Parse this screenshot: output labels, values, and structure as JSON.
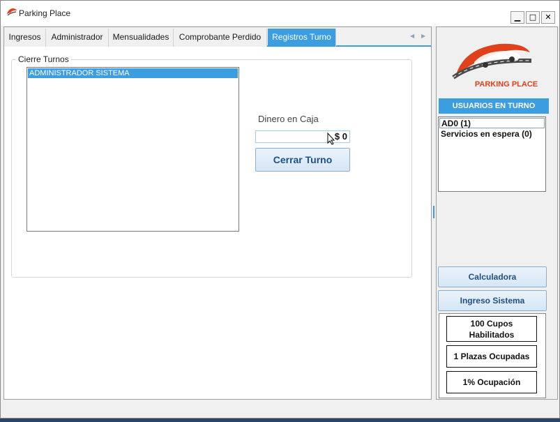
{
  "window": {
    "title": "Parking Place",
    "controls": {
      "minimize": "▁",
      "maximize": "□",
      "close": "✕"
    }
  },
  "tabs": [
    {
      "label": "Ingresos",
      "active": false
    },
    {
      "label": "Administrador",
      "active": false
    },
    {
      "label": "Mensualidades",
      "active": false
    },
    {
      "label": "Comprobante Perdido",
      "active": false
    },
    {
      "label": "Registros Turno",
      "active": true
    }
  ],
  "tab_scroll": {
    "left": "◀",
    "right": "▶"
  },
  "cierre": {
    "group_title": "Cierre Turnos",
    "users": [
      "ADMINISTRADOR SISTEMA"
    ],
    "cash_label": "Dinero en Caja",
    "cash_value": "$ 0",
    "close_button": "Cerrar Turno"
  },
  "side": {
    "logo_text": "PARKING PLACE",
    "users_header": "USUARIOS EN TURNO",
    "users": [
      "AD0 (1)",
      "Servicios en espera (0)"
    ],
    "calc_button": "Calculadora",
    "login_button": "Ingreso Sistema",
    "stats": {
      "cupos": "100 Cupos Habilitados",
      "ocupadas": "1 Plazas Ocupadas",
      "ocupacion": "1% Ocupación"
    }
  },
  "colors": {
    "accent": "#3c9ee0",
    "button_text": "#1f4f86",
    "logo": "#e0401a"
  }
}
